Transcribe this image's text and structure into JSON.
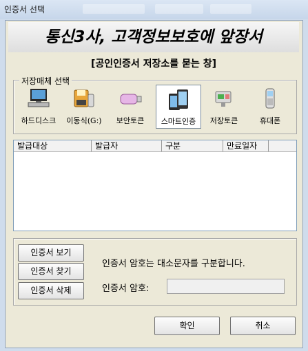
{
  "window": {
    "title": "인증서 선택"
  },
  "header": {
    "headline": "통신3사, 고객정보보호에 앞장서",
    "subtitle": "[공인인증서 저장소를 묻는 창]"
  },
  "storage": {
    "legend": "저장매체 선택",
    "items": [
      {
        "label": "하드디스크",
        "icon": "computer-icon"
      },
      {
        "label": "이동식(G:)",
        "icon": "removable-disk-icon"
      },
      {
        "label": "보안토큰",
        "icon": "usb-token-icon"
      },
      {
        "label": "스마트인증",
        "icon": "smartphone-icon",
        "selected": true
      },
      {
        "label": "저장토큰",
        "icon": "storage-token-icon"
      },
      {
        "label": "휴대폰",
        "icon": "mobile-phone-icon"
      }
    ]
  },
  "cert_table": {
    "columns": [
      "발급대상",
      "발급자",
      "구분",
      "만료일자"
    ],
    "rows": []
  },
  "actions": {
    "view": "인증서 보기",
    "find": "인증서 찾기",
    "delete": "인증서 삭제"
  },
  "password": {
    "notice": "인증서 암호는 대소문자를 구분합니다.",
    "label": "인증서 암호:",
    "value": ""
  },
  "buttons": {
    "ok": "확인",
    "cancel": "취소"
  }
}
